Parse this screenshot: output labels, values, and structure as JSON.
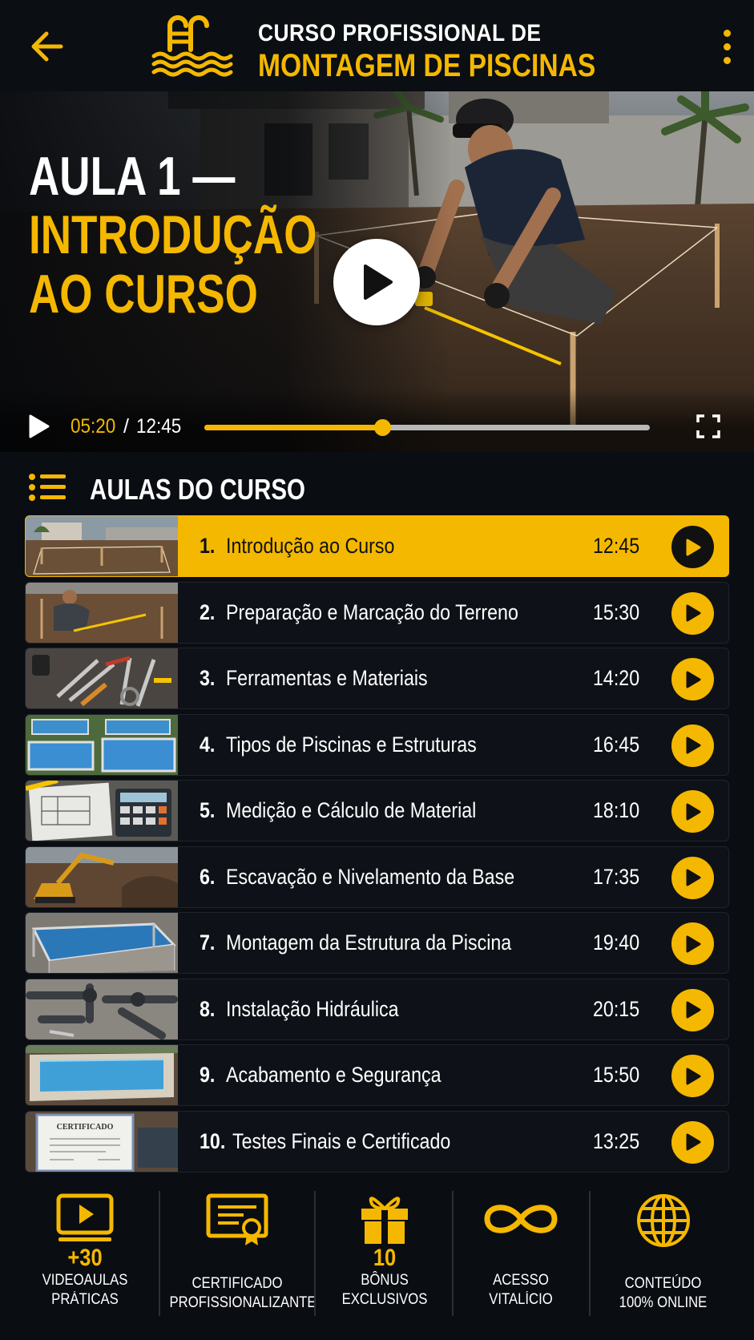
{
  "header": {
    "back_icon": "arrow-left-icon",
    "logo_icon": "pool-ladder-icon",
    "title_line1": "CURSO PROFISSIONAL DE",
    "title_line2": "MONTAGEM DE PISCINAS",
    "menu_icon": "more-vertical-icon"
  },
  "video": {
    "title_line1": "AULA 1 —",
    "title_line2": "INTRODUÇÃO",
    "title_line3": "AO CURSO",
    "current_time": "05:20",
    "separator": "/",
    "total_time": "12:45",
    "progress": 0.4,
    "play_icon": "play-icon",
    "fullscreen_icon": "fullscreen-icon"
  },
  "lessons_section": {
    "title": "AULAS DO CURSO",
    "icon": "list-icon",
    "items": [
      {
        "num": "1.",
        "title": "Introdução ao Curso",
        "duration": "12:45",
        "active": true
      },
      {
        "num": "2.",
        "title": "Preparação e Marcação do Terreno",
        "duration": "15:30"
      },
      {
        "num": "3.",
        "title": "Ferramentas e Materiais",
        "duration": "14:20"
      },
      {
        "num": "4.",
        "title": "Tipos de Piscinas e Estruturas",
        "duration": "16:45"
      },
      {
        "num": "5.",
        "title": "Medição e Cálculo de Material",
        "duration": "18:10"
      },
      {
        "num": "6.",
        "title": "Escavação e Nivelamento da Base",
        "duration": "17:35"
      },
      {
        "num": "7.",
        "title": "Montagem da Estrutura da Piscina",
        "duration": "19:40"
      },
      {
        "num": "8.",
        "title": "Instalação Hidráulica",
        "duration": "20:15"
      },
      {
        "num": "9.",
        "title": "Acabamento e Segurança",
        "duration": "15:50"
      },
      {
        "num": "10.",
        "title": "Testes Finais e Certificado",
        "duration": "13:25"
      }
    ],
    "thumb_text_10": "CERTIFICADO"
  },
  "features": [
    {
      "icon": "video-player-icon",
      "big": "+30",
      "line1": "VIDEOAULAS",
      "line2": "PRÁTICAS"
    },
    {
      "icon": "certificate-icon",
      "big": "",
      "line1": "CERTIFICADO",
      "line2": "PROFISSIONALIZANTE"
    },
    {
      "icon": "gift-icon",
      "big": "10",
      "line1": "BÔNUS",
      "line2": "EXCLUSIVOS"
    },
    {
      "icon": "infinity-icon",
      "big": "",
      "line1": "ACESSO",
      "line2": "VITALÍCIO"
    },
    {
      "icon": "globe-icon",
      "big": "",
      "line1": "CONTEÚDO",
      "line2": "100% ONLINE"
    }
  ],
  "colors": {
    "accent": "#f5b800",
    "background": "#0a0d12",
    "text": "#ffffff"
  }
}
